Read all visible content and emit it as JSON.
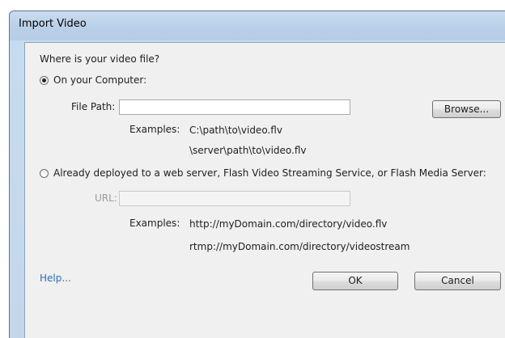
{
  "window": {
    "title": "Import Video"
  },
  "form": {
    "question": "Where is your video file?",
    "option_computer": "On your Computer:",
    "file_path_label": "File Path:",
    "file_path_value": "",
    "browse_label": "Browse...",
    "examples_label_1": "Examples:",
    "example_local_1": "C:\\path\\to\\video.flv",
    "example_local_2": "\\server\\path\\to\\video.flv",
    "option_server": "Already deployed to a web server, Flash Video Streaming Service, or Flash Media Server:",
    "url_label": "URL:",
    "url_value": "",
    "examples_label_2": "Examples:",
    "example_url_1": "http://myDomain.com/directory/video.flv",
    "example_url_2": "rtmp://myDomain.com/directory/videostream",
    "selected_option": "computer"
  },
  "footer": {
    "help_label": "Help...",
    "ok_label": "OK",
    "cancel_label": "Cancel"
  }
}
